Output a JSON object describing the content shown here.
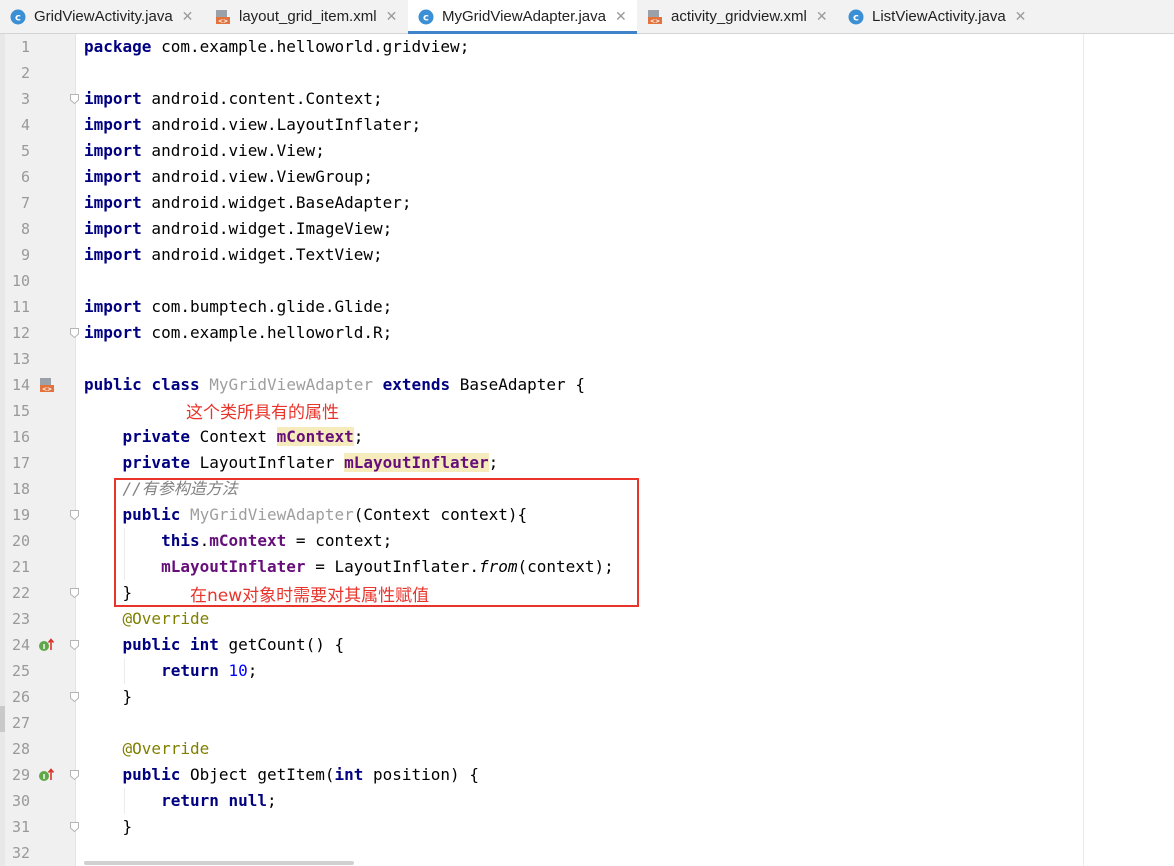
{
  "tabs": [
    {
      "label": "GridViewActivity.java",
      "icon": "java-class-icon",
      "active": false
    },
    {
      "label": "layout_grid_item.xml",
      "icon": "xml-layout-icon",
      "active": false
    },
    {
      "label": "MyGridViewAdapter.java",
      "icon": "java-class-icon",
      "active": true
    },
    {
      "label": "activity_gridview.xml",
      "icon": "xml-layout-icon",
      "active": false
    },
    {
      "label": "ListViewActivity.java",
      "icon": "java-class-icon",
      "active": false
    }
  ],
  "tab_close_glyph": "✕",
  "colors": {
    "keyword": "#000080",
    "field": "#660e7a",
    "annotation": "#808000",
    "number": "#0000ff",
    "unused": "#9e9e9e",
    "comment": "#808080",
    "note_red": "#e8342b",
    "tab_accent": "#4083c9",
    "java_icon": "#3b8fd4",
    "xml_icon": "#e2733d"
  },
  "editor": {
    "line_numbers": [
      "1",
      "2",
      "3",
      "4",
      "5",
      "6",
      "7",
      "8",
      "9",
      "10",
      "11",
      "12",
      "13",
      "14",
      "15",
      "16",
      "17",
      "18",
      "19",
      "20",
      "21",
      "22",
      "23",
      "24",
      "25",
      "26",
      "27",
      "28",
      "29",
      "30",
      "31",
      "32"
    ],
    "lines": [
      [
        {
          "t": "package",
          "c": "kw"
        },
        {
          "t": " com.example.helloworld.gridview;"
        }
      ],
      [],
      [
        {
          "t": "import",
          "c": "kw"
        },
        {
          "t": " android.content.Context;"
        }
      ],
      [
        {
          "t": "import",
          "c": "kw"
        },
        {
          "t": " android.view.LayoutInflater;"
        }
      ],
      [
        {
          "t": "import",
          "c": "kw"
        },
        {
          "t": " android.view.View;"
        }
      ],
      [
        {
          "t": "import",
          "c": "kw"
        },
        {
          "t": " android.view.ViewGroup;"
        }
      ],
      [
        {
          "t": "import",
          "c": "kw"
        },
        {
          "t": " android.widget.BaseAdapter;"
        }
      ],
      [
        {
          "t": "import",
          "c": "kw"
        },
        {
          "t": " android.widget.ImageView;"
        }
      ],
      [
        {
          "t": "import",
          "c": "kw"
        },
        {
          "t": " android.widget.TextView;"
        }
      ],
      [],
      [
        {
          "t": "import",
          "c": "kw"
        },
        {
          "t": " com.bumptech.glide.Glide;"
        }
      ],
      [
        {
          "t": "import",
          "c": "kw"
        },
        {
          "t": " com.example.helloworld.R;"
        }
      ],
      [],
      [
        {
          "t": "public",
          "c": "kw"
        },
        {
          "t": " "
        },
        {
          "t": "class",
          "c": "kw"
        },
        {
          "t": " "
        },
        {
          "t": "MyGridViewAdapter",
          "c": "gray"
        },
        {
          "t": " "
        },
        {
          "t": "extends",
          "c": "kw"
        },
        {
          "t": " BaseAdapter {"
        }
      ],
      [],
      [
        {
          "t": "    "
        },
        {
          "t": "private",
          "c": "kw"
        },
        {
          "t": " Context "
        },
        {
          "t": "mContext",
          "c": "fldhl"
        },
        {
          "t": ";"
        }
      ],
      [
        {
          "t": "    "
        },
        {
          "t": "private",
          "c": "kw"
        },
        {
          "t": " LayoutInflater "
        },
        {
          "t": "mLayoutInflater",
          "c": "fldhl"
        },
        {
          "t": ";"
        }
      ],
      [
        {
          "t": "    "
        },
        {
          "t": "//有参构造方法",
          "c": "cmt"
        }
      ],
      [
        {
          "t": "    "
        },
        {
          "t": "public",
          "c": "kw"
        },
        {
          "t": " "
        },
        {
          "t": "MyGridViewAdapter",
          "c": "gray"
        },
        {
          "t": "(Context context){"
        }
      ],
      [
        {
          "t": "        "
        },
        {
          "t": "this",
          "c": "kw"
        },
        {
          "t": "."
        },
        {
          "t": "mContext",
          "c": "fld"
        },
        {
          "t": " = context;"
        }
      ],
      [
        {
          "t": "        "
        },
        {
          "t": "mLayoutInflater",
          "c": "fld"
        },
        {
          "t": " = LayoutInflater."
        },
        {
          "t": "from",
          "c": "ital"
        },
        {
          "t": "(context);"
        }
      ],
      [
        {
          "t": "    }"
        }
      ],
      [
        {
          "t": "    "
        },
        {
          "t": "@Override",
          "c": "ann"
        }
      ],
      [
        {
          "t": "    "
        },
        {
          "t": "public",
          "c": "kw"
        },
        {
          "t": " "
        },
        {
          "t": "int",
          "c": "kw"
        },
        {
          "t": " getCount() {"
        }
      ],
      [
        {
          "t": "        "
        },
        {
          "t": "return",
          "c": "kw"
        },
        {
          "t": " "
        },
        {
          "t": "10",
          "c": "num"
        },
        {
          "t": ";"
        }
      ],
      [
        {
          "t": "    }"
        }
      ],
      [],
      [
        {
          "t": "    "
        },
        {
          "t": "@Override",
          "c": "ann"
        }
      ],
      [
        {
          "t": "    "
        },
        {
          "t": "public",
          "c": "kw"
        },
        {
          "t": " Object getItem("
        },
        {
          "t": "int",
          "c": "kw"
        },
        {
          "t": " position) {"
        }
      ],
      [
        {
          "t": "        "
        },
        {
          "t": "return",
          "c": "kw"
        },
        {
          "t": " "
        },
        {
          "t": "null",
          "c": "kw"
        },
        {
          "t": ";"
        }
      ],
      [
        {
          "t": "    }"
        }
      ],
      []
    ]
  },
  "gutter_icons": [
    {
      "line": 14,
      "icon": "xml-layout-icon"
    },
    {
      "line": 24,
      "icon": "implements-method-icon"
    },
    {
      "line": 29,
      "icon": "implements-method-icon"
    }
  ],
  "fold_lines": [
    3,
    12,
    19,
    22,
    24,
    26,
    29,
    31
  ],
  "annotations": {
    "note1": "这个类所具有的属性",
    "note2": "在new对象时需要对其属性赋值"
  }
}
